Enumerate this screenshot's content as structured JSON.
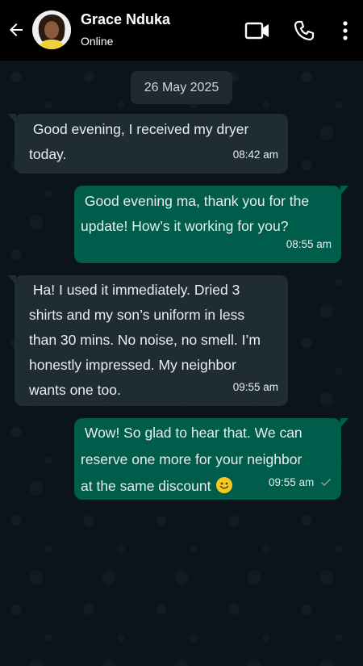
{
  "header": {
    "contact_name": "Grace Nduka",
    "status": "Online",
    "icons": [
      "back-arrow-icon",
      "avatar",
      "video-call-icon",
      "voice-call-icon",
      "more-options-icon"
    ],
    "background_color": "#000000"
  },
  "chat": {
    "date_label": "26 May 2025",
    "messages": [
      {
        "direction": "incoming",
        "text": " Good evening, I received my dryer\ntoday.",
        "time": "08:42 am"
      },
      {
        "direction": "outgoing",
        "text": " Good evening ma, thank you for the\nupdate! How’s it working for you?",
        "time": "08:55 am"
      },
      {
        "direction": "incoming",
        "text": " Ha! I used it immediately. Dried 3\nshirts and my son’s uniform in less\nthan 30 mins. No noise, no smell. I’m\nhonestly impressed. My neighbor\nwants one too.",
        "time": "09:55 am"
      },
      {
        "direction": "outgoing",
        "text": " Wow! So glad to hear that. We can\nreserve one more for your neighbor\nat the same discount",
        "emoji": "smiling-face-emoji",
        "time": "09:55 am",
        "status_icon": "single-check-icon"
      }
    ]
  },
  "colors": {
    "chat_background": "#0b141a",
    "incoming_bubble": "#202c33",
    "outgoing_bubble": "#005c4b",
    "date_chip": "#1e2a30"
  }
}
